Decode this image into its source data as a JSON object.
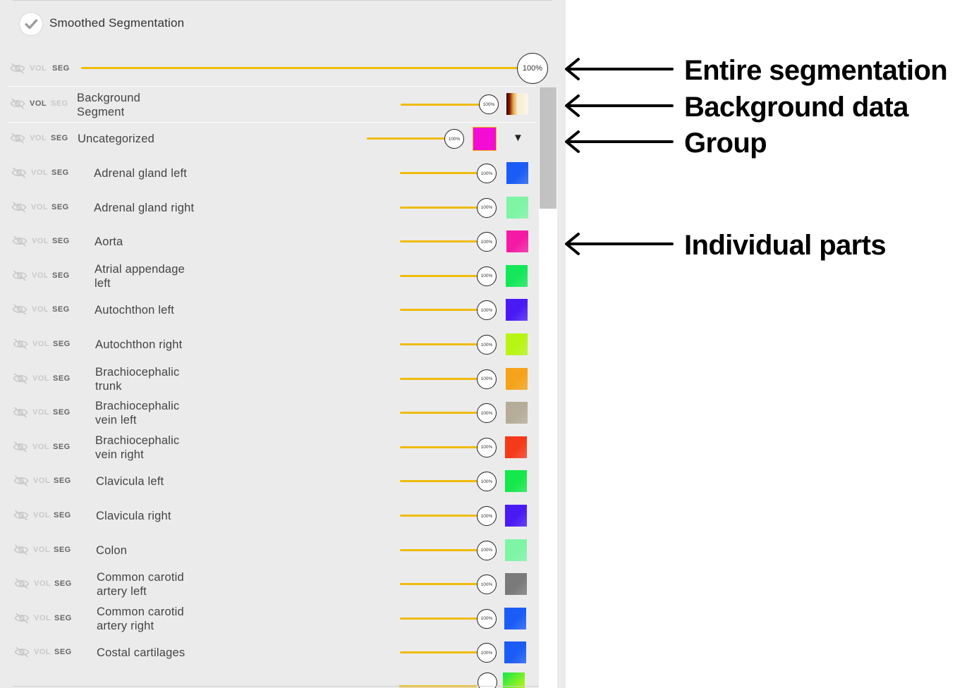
{
  "panel": {
    "smoothed_label": "Smoothed Segmentation",
    "vol_label": "VOL",
    "seg_label": "SEG",
    "opacity_label": "100%",
    "accent": "#f0bb08",
    "entire": {
      "percent": "100%"
    },
    "background": {
      "name": "Background Segment",
      "percent": "100%"
    },
    "group": {
      "name": "Uncategorized",
      "percent": "100%",
      "swatch": "#f20cd4",
      "dropdown": "▼"
    },
    "segments": [
      {
        "name": "Adrenal gland left",
        "percent": "100%",
        "color": "#1a5cf5"
      },
      {
        "name": "Adrenal gland right",
        "percent": "100%",
        "color": "#7df5a5"
      },
      {
        "name": "Aorta",
        "percent": "100%",
        "color": "#f51aa5"
      },
      {
        "name": "Atrial appendage left",
        "percent": "100%",
        "color": "#14e85a"
      },
      {
        "name": "Autochthon left",
        "percent": "100%",
        "color": "#4a1af5"
      },
      {
        "name": "Autochthon right",
        "percent": "100%",
        "color": "#b8f514"
      },
      {
        "name": "Brachiocephalic trunk",
        "percent": "100%",
        "color": "#f5a31a"
      },
      {
        "name": "Brachiocephalic vein left",
        "percent": "100%",
        "color": "#b5ad99"
      },
      {
        "name": "Brachiocephalic vein right",
        "percent": "100%",
        "color": "#f53a1a"
      },
      {
        "name": "Clavicula left",
        "percent": "100%",
        "color": "#14e84a"
      },
      {
        "name": "Clavicula right",
        "percent": "100%",
        "color": "#4a1af5"
      },
      {
        "name": "Colon",
        "percent": "100%",
        "color": "#7df5a5"
      },
      {
        "name": "Common carotid artery left",
        "percent": "100%",
        "color": "#7a7a7a"
      },
      {
        "name": "Common carotid artery right",
        "percent": "100%",
        "color": "#1a5cf5"
      },
      {
        "name": "Costal cartilages",
        "percent": "100%",
        "color": "#1a5cf5"
      }
    ]
  },
  "annotations": [
    {
      "label": "Entire segmentation"
    },
    {
      "label": "Background data"
    },
    {
      "label": "Group"
    },
    {
      "label": "Individual parts"
    }
  ]
}
